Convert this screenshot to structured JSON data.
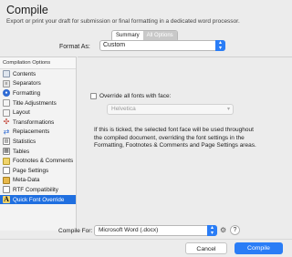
{
  "header": {
    "title": "Compile",
    "subtitle": "Export or print your draft for submission or final formatting in a dedicated word processor."
  },
  "tabs": [
    {
      "label": "Summary",
      "active": false
    },
    {
      "label": "All Options",
      "active": true
    }
  ],
  "format": {
    "label": "Format As:",
    "value": "Custom"
  },
  "sidebar": {
    "heading": "Compilation Options",
    "items": [
      {
        "label": "Contents",
        "icon": "contents-icon"
      },
      {
        "label": "Separators",
        "icon": "separators-icon"
      },
      {
        "label": "Formatting",
        "icon": "formatting-icon"
      },
      {
        "label": "Title Adjustments",
        "icon": "title-adjustments-icon"
      },
      {
        "label": "Layout",
        "icon": "layout-icon"
      },
      {
        "label": "Transformations",
        "icon": "transformations-icon"
      },
      {
        "label": "Replacements",
        "icon": "replacements-icon"
      },
      {
        "label": "Statistics",
        "icon": "statistics-icon"
      },
      {
        "label": "Tables",
        "icon": "tables-icon"
      },
      {
        "label": "Footnotes & Comments",
        "icon": "footnotes-icon"
      },
      {
        "label": "Page Settings",
        "icon": "page-settings-icon"
      },
      {
        "label": "Meta-Data",
        "icon": "meta-data-icon"
      },
      {
        "label": "RTF Compatibility",
        "icon": "rtf-icon"
      },
      {
        "label": "Quick Font Override",
        "icon": "font-override-icon",
        "selected": true
      }
    ]
  },
  "main": {
    "override_label": "Override all fonts with face:",
    "override_checked": false,
    "font_value": "Helvetica",
    "description": "If this is ticked, the selected font face will be used throughout the compiled document, overriding the font settings in the Formatting, Footnotes & Comments and Page Settings areas."
  },
  "footer": {
    "compile_for_label": "Compile For:",
    "compile_for_value": "Microsoft Word (.docx)",
    "help_label": "?",
    "cancel_label": "Cancel",
    "compile_label": "Compile"
  },
  "colors": {
    "accent": "#2a7df6",
    "selection": "#1f6fe0"
  }
}
